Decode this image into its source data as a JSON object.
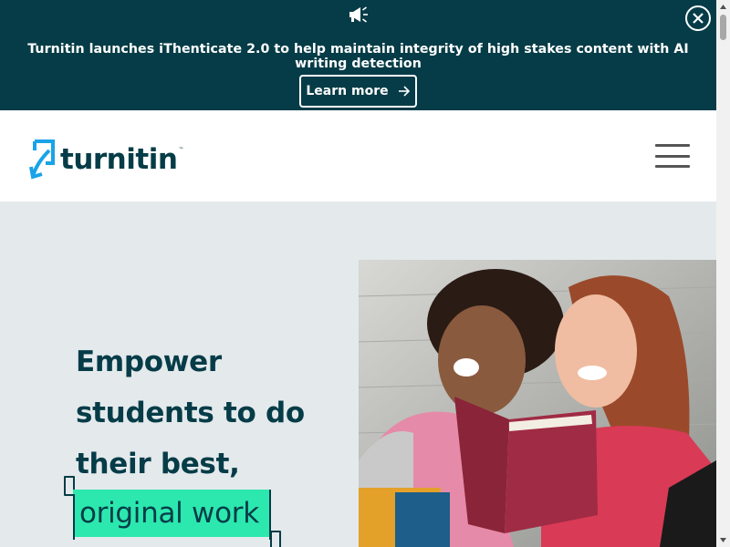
{
  "banner": {
    "icon": "megaphone-icon",
    "text": "Turnitin launches iThenticate 2.0 to help maintain integrity of high stakes content with AI writing detection",
    "button_label": "Learn more",
    "close_icon": "close-icon"
  },
  "header": {
    "logo_text": "turnitin",
    "logo_tm": "™",
    "menu_icon": "hamburger-menu-icon"
  },
  "hero": {
    "headline_line1": "Empower",
    "headline_line2": "students to do",
    "headline_line3": "their best,",
    "highlight": "original work"
  },
  "colors": {
    "banner_bg": "#053c47",
    "hero_bg": "#e4e9ec",
    "accent": "#2ce8ae",
    "logo_blue": "#1aa3e8",
    "text_dark": "#053c47"
  }
}
